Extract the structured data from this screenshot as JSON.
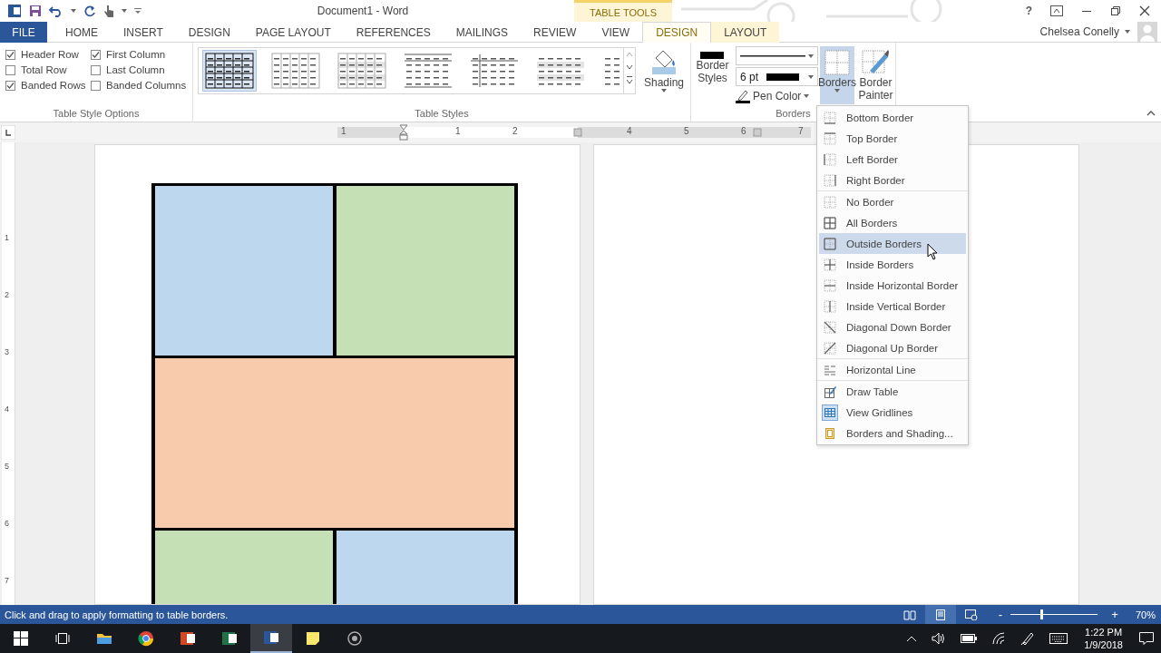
{
  "title_bar": {
    "title": "Document1 - Word",
    "context_label": "TABLE TOOLS",
    "help": "?"
  },
  "tabs": [
    {
      "label": "FILE",
      "kind": "file",
      "selected": false
    },
    {
      "label": "HOME",
      "kind": "normal",
      "selected": false
    },
    {
      "label": "INSERT",
      "kind": "normal",
      "selected": false
    },
    {
      "label": "DESIGN",
      "kind": "normal",
      "selected": false
    },
    {
      "label": "PAGE LAYOUT",
      "kind": "normal",
      "selected": false
    },
    {
      "label": "REFERENCES",
      "kind": "normal",
      "selected": false
    },
    {
      "label": "MAILINGS",
      "kind": "normal",
      "selected": false
    },
    {
      "label": "REVIEW",
      "kind": "normal",
      "selected": false
    },
    {
      "label": "VIEW",
      "kind": "normal",
      "selected": false
    },
    {
      "label": "DESIGN",
      "kind": "contextual",
      "selected": true
    },
    {
      "label": "LAYOUT",
      "kind": "contextual",
      "selected": false
    }
  ],
  "user": {
    "name": "Chelsea Conelly"
  },
  "table_style_options": {
    "label": "Table Style Options",
    "checkboxes": [
      {
        "label": "Header Row",
        "checked": true
      },
      {
        "label": "First Column",
        "checked": true
      },
      {
        "label": "Total Row",
        "checked": false
      },
      {
        "label": "Last Column",
        "checked": false
      },
      {
        "label": "Banded Rows",
        "checked": true
      },
      {
        "label": "Banded Columns",
        "checked": false
      }
    ]
  },
  "table_styles": {
    "label": "Table Styles",
    "styles": [
      {
        "kind": "grid",
        "selected": true
      },
      {
        "kind": "light",
        "selected": false
      },
      {
        "kind": "shaded",
        "selected": false
      },
      {
        "kind": "lines",
        "selected": false
      },
      {
        "kind": "first_col",
        "selected": false
      },
      {
        "kind": "banded",
        "selected": false
      },
      {
        "kind": "plain",
        "selected": false
      }
    ],
    "shading": "Shading"
  },
  "borders_group": {
    "label": "Borders",
    "border_styles": "Border Styles",
    "weight": "6 pt",
    "pen_color": "Pen Color",
    "borders": "Borders",
    "borders_pressed": true,
    "border_painter": "Border Painter"
  },
  "ruler": {
    "numbers": [
      "1",
      "1",
      "2",
      "4",
      "5",
      "6",
      "7"
    ],
    "vertical_numbers": [
      "1",
      "2",
      "3",
      "4",
      "5",
      "6",
      "7"
    ]
  },
  "document_table": {
    "rows": [
      [
        {
          "color": "#bdd7ee"
        },
        {
          "color": "#c5e0b4"
        }
      ],
      [
        {
          "color": "#f8cbad"
        }
      ],
      [
        {
          "color": "#c5e0b4"
        },
        {
          "color": "#bdd7ee"
        }
      ]
    ]
  },
  "borders_menu": {
    "groups": [
      [
        {
          "label": "Bottom Border",
          "kind": "bottom",
          "selected": false,
          "on": false
        },
        {
          "label": "Top Border",
          "kind": "top",
          "selected": false,
          "on": false
        },
        {
          "label": "Left Border",
          "kind": "left",
          "selected": false,
          "on": false
        },
        {
          "label": "Right Border",
          "kind": "right",
          "selected": false,
          "on": false
        }
      ],
      [
        {
          "label": "No Border",
          "kind": "none",
          "selected": false,
          "on": false
        },
        {
          "label": "All Borders",
          "kind": "all",
          "selected": false,
          "on": false
        },
        {
          "label": "Outside Borders",
          "kind": "outside",
          "selected": true,
          "on": false
        },
        {
          "label": "Inside Borders",
          "kind": "inside",
          "selected": false,
          "on": false
        },
        {
          "label": "Inside Horizontal Border",
          "kind": "inside_h",
          "selected": false,
          "on": false
        },
        {
          "label": "Inside Vertical Border",
          "kind": "inside_v",
          "selected": false,
          "on": false
        },
        {
          "label": "Diagonal Down Border",
          "kind": "diag_down",
          "selected": false,
          "on": false
        },
        {
          "label": "Diagonal Up Border",
          "kind": "diag_up",
          "selected": false,
          "on": false
        }
      ],
      [
        {
          "label": "Horizontal Line",
          "kind": "hline",
          "selected": false,
          "on": false
        }
      ],
      [
        {
          "label": "Draw Table",
          "kind": "draw",
          "selected": false,
          "on": false
        },
        {
          "label": "View Gridlines",
          "kind": "gridlines",
          "selected": false,
          "on": true
        },
        {
          "label": "Borders and Shading...",
          "kind": "dialog",
          "selected": false,
          "on": false
        }
      ]
    ]
  },
  "status_bar": {
    "message": "Click and drag to apply formatting to table borders.",
    "views": [
      {
        "kind": "read",
        "selected": false
      },
      {
        "kind": "print",
        "selected": true
      },
      {
        "kind": "web",
        "selected": false
      }
    ],
    "zoom_out": "-",
    "zoom_in": "+",
    "zoom": {
      "level": 0.34,
      "reading": "70%"
    }
  },
  "taskbar": {
    "apps": [
      {
        "kind": "start",
        "selected": false
      },
      {
        "kind": "taskview",
        "selected": false
      },
      {
        "kind": "folder",
        "selected": false
      },
      {
        "kind": "browser",
        "selected": false
      },
      {
        "kind": "slides",
        "selected": false
      },
      {
        "kind": "sheet",
        "selected": false
      },
      {
        "kind": "doc",
        "selected": true
      },
      {
        "kind": "notes",
        "selected": false
      },
      {
        "kind": "ring",
        "selected": false
      }
    ],
    "time": "1:22 PM",
    "date": "1/9/2018"
  }
}
